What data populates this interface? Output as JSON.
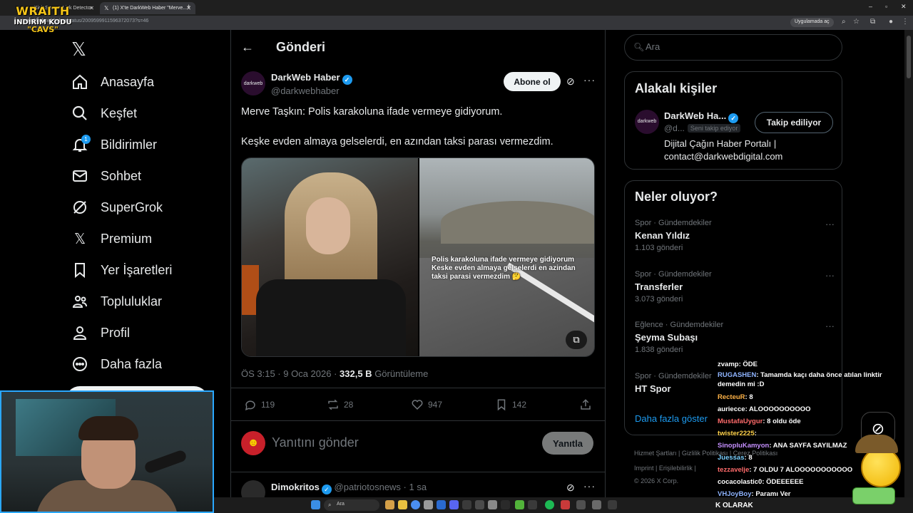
{
  "browser": {
    "tabs": [
      {
        "title": "Kick Stream Link Detector"
      },
      {
        "title": "(1) X'te DarkWeb Haber \"Merve..."
      }
    ],
    "url": "x.com/darkwebhaber/status/2009599911596372073?s=46",
    "open_app_label": "Uygulamada aç"
  },
  "overlay_logo": {
    "line1": "WRAITH",
    "line2": "İNDİRİM KODU",
    "line3": "\"CAVS\""
  },
  "nav": {
    "items": [
      {
        "label": "Anasayfa",
        "icon": "home-icon"
      },
      {
        "label": "Keşfet",
        "icon": "search-icon"
      },
      {
        "label": "Bildirimler",
        "icon": "bell-icon",
        "badge": "1"
      },
      {
        "label": "Sohbet",
        "icon": "mail-icon"
      },
      {
        "label": "SuperGrok",
        "icon": "grok-icon"
      },
      {
        "label": "Premium",
        "icon": "x-logo-icon"
      },
      {
        "label": "Yer İşaretleri",
        "icon": "bookmark-icon"
      },
      {
        "label": "Topluluklar",
        "icon": "communities-icon"
      },
      {
        "label": "Profil",
        "icon": "profile-icon"
      },
      {
        "label": "Daha fazla",
        "icon": "more-circle-icon"
      }
    ]
  },
  "header": {
    "title": "Gönderi"
  },
  "tweet": {
    "author_name": "DarkWeb Haber",
    "author_handle": "@darkwebhaber",
    "avatar_text": "darkweb",
    "subscribe_label": "Abone ol",
    "text_line1": "Merve Taşkın: Polis karakoluna ifade vermeye gidiyorum.",
    "text_line2": "Keşke evden almaya gelselerdi, en azından taksi parası vermezdim.",
    "media_overlay_text": "Polis karakoluna ifade vermeye gidiyorum Keske evden almaya gelselerdi en azindan taksi parasi vermezdim 🤔",
    "time": "ÖS 3:15 · 9 Oca 2026 · ",
    "views": "332,5 B",
    "views_label": " Görüntüleme",
    "replies": "119",
    "reposts": "28",
    "likes": "947",
    "bookmarks": "142"
  },
  "reply_box": {
    "placeholder": "Yanıtını gönder",
    "button_label": "Yanıtla"
  },
  "next_tweet": {
    "author_name": "Dimokritos",
    "author_handle": "@patriotosnews · 1 sa"
  },
  "search": {
    "placeholder": "Ara"
  },
  "related": {
    "title": "Alakalı kişiler",
    "name": "DarkWeb Ha...",
    "handle": "@d...",
    "follows_you": "Seni takip ediyor",
    "button_label": "Takip ediliyor",
    "bio_line1": "Dijital Çağın Haber Portalı |",
    "bio_line2": "contact@darkwebdigital.com"
  },
  "trends": {
    "title": "Neler oluyor?",
    "items": [
      {
        "category": "Spor · Gündemdekiler",
        "name": "Kenan Yıldız",
        "count": "1.103 gönderi"
      },
      {
        "category": "Spor · Gündemdekiler",
        "name": "Transferler",
        "count": "3.073 gönderi"
      },
      {
        "category": "Eğlence · Gündemdekiler",
        "name": "Şeyma Subaşı",
        "count": "1.838 gönderi"
      },
      {
        "category": "Spor · Gündemdekiler",
        "name": "HT Spor",
        "count": ""
      }
    ],
    "show_more": "Daha fazla göster"
  },
  "footer": {
    "line1": "Hizmet Şartları  |  Gizlilik Politikası  |  Çerez Politikası",
    "line2": "Imprint  |  Erişilebilirlik  |",
    "line3": "© 2026 X Corp."
  },
  "chat": [
    {
      "name": "zvamp",
      "color": "#ffffff",
      "msg": ": ÖDE"
    },
    {
      "name": "RUGASHEN",
      "color": "#8fb4ff",
      "msg": ": Tamamda kaçı daha önce atılan linktir demedin mi :D"
    },
    {
      "name": "RecteuR",
      "color": "#ffb347",
      "msg": ": 8"
    },
    {
      "name": "auriecce",
      "color": "#ffffff",
      "msg": ": ALOOOOOOOOOO"
    },
    {
      "name": "MustafaUygur",
      "color": "#ff6b6b",
      "msg": ": 8 oldu öde"
    },
    {
      "name": "twister2225",
      "color": "#ffd24a",
      "msg": ":"
    },
    {
      "name": "SinopluKamyon",
      "color": "#c690ff",
      "msg": ": ANA SAYFA SAYILMAZ"
    },
    {
      "name": "Juessas",
      "color": "#7ad0ff",
      "msg": ": 8"
    },
    {
      "name": "tezzavelje",
      "color": "#ff6b6b",
      "msg": ": 7 OLDU 7 ALOOOOOOOOOOO"
    },
    {
      "name": "cocacolastic0",
      "color": "#ffffff",
      "msg": ": ÖDEEEEEE"
    },
    {
      "name": "VHJoyBoy",
      "color": "#8fb4ff",
      "msg": ": Paramı Ver"
    }
  ],
  "ticker": "K OLARAK",
  "taskbar": {
    "search_placeholder": "Ara"
  }
}
